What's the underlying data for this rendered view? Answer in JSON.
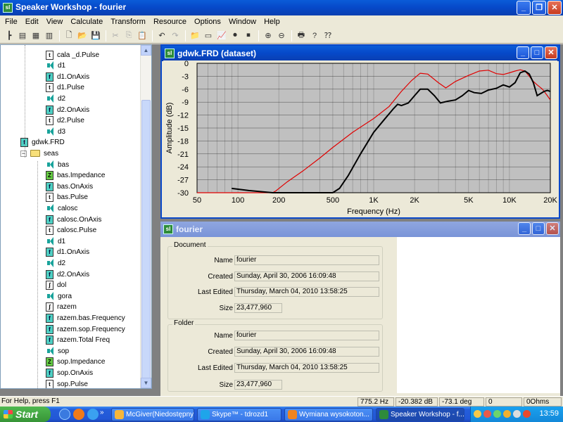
{
  "app": {
    "title": "Speaker Workshop - fourier",
    "icon_label": "sl"
  },
  "menu": [
    "File",
    "Edit",
    "View",
    "Calculate",
    "Transform",
    "Resource",
    "Options",
    "Window",
    "Help"
  ],
  "tree": {
    "items": [
      {
        "label": "cala _d.Pulse",
        "icon": "t",
        "indent": 2
      },
      {
        "label": "d1",
        "icon": "spk",
        "indent": 2
      },
      {
        "label": "d1.OnAxis",
        "icon": "f",
        "indent": 2
      },
      {
        "label": "d1.Pulse",
        "icon": "t",
        "indent": 2
      },
      {
        "label": "d2",
        "icon": "spk",
        "indent": 2
      },
      {
        "label": "d2.OnAxis",
        "icon": "f",
        "indent": 2
      },
      {
        "label": "d2.Pulse",
        "icon": "t",
        "indent": 2
      },
      {
        "label": "d3",
        "icon": "spk",
        "indent": 2
      },
      {
        "label": "gdwk.FRD",
        "icon": "f",
        "indent": 1
      },
      {
        "label": "seas",
        "icon": "folder",
        "indent": 1
      },
      {
        "label": "bas",
        "icon": "spk",
        "indent": 2
      },
      {
        "label": "bas.Impedance",
        "icon": "z",
        "indent": 2
      },
      {
        "label": "bas.OnAxis",
        "icon": "f",
        "indent": 2
      },
      {
        "label": "bas.Pulse",
        "icon": "t",
        "indent": 2
      },
      {
        "label": "calosc",
        "icon": "spk",
        "indent": 2
      },
      {
        "label": "calosc.OnAxis",
        "icon": "f",
        "indent": 2
      },
      {
        "label": "calosc.Pulse",
        "icon": "t",
        "indent": 2
      },
      {
        "label": "d1",
        "icon": "spk",
        "indent": 2
      },
      {
        "label": "d1.OnAxis",
        "icon": "f",
        "indent": 2
      },
      {
        "label": "d2",
        "icon": "spk",
        "indent": 2
      },
      {
        "label": "d2.OnAxis",
        "icon": "f",
        "indent": 2
      },
      {
        "label": "dol",
        "icon": "g",
        "indent": 2
      },
      {
        "label": "gora",
        "icon": "spk",
        "indent": 2
      },
      {
        "label": "razem",
        "icon": "g",
        "indent": 2
      },
      {
        "label": "razem.bas.Frequency",
        "icon": "f",
        "indent": 2
      },
      {
        "label": "razem.sop.Frequency",
        "icon": "f",
        "indent": 2
      },
      {
        "label": "razem.Total Freq",
        "icon": "f",
        "indent": 2
      },
      {
        "label": "sop",
        "icon": "spk",
        "indent": 2
      },
      {
        "label": "sop.Impedance",
        "icon": "z",
        "indent": 2
      },
      {
        "label": "sop.OnAxis",
        "icon": "f",
        "indent": 2
      },
      {
        "label": "sop.Pulse",
        "icon": "t",
        "indent": 2
      }
    ]
  },
  "chart_window": {
    "title": "gdwk.FRD (dataset)"
  },
  "chart_data": {
    "type": "line",
    "xscale": "log",
    "xlabel": "Frequency (Hz)",
    "ylabel": "Amplitude (dB)",
    "xlim": [
      50,
      20000
    ],
    "ylim": [
      -30,
      0
    ],
    "x_ticks": [
      50,
      100,
      200,
      500,
      1000,
      2000,
      5000,
      10000,
      20000
    ],
    "x_tick_labels": [
      "50",
      "100",
      "200",
      "500",
      "1K",
      "2K",
      "5K",
      "10K",
      "20K"
    ],
    "y_ticks": [
      0,
      -3,
      -6,
      -9,
      -12,
      -15,
      -18,
      -21,
      -24,
      -27,
      -30
    ],
    "y_tick_labels": [
      "0",
      "-3",
      "-6",
      "-9",
      "-12",
      "-15",
      "-18",
      "-21",
      "-24",
      "-27",
      "-30"
    ],
    "grid": true,
    "background": "#c0c0c0",
    "series": [
      {
        "color": "#e00000",
        "points": [
          [
            50,
            -30
          ],
          [
            100,
            -30
          ],
          [
            180,
            -30
          ],
          [
            190,
            -29.6
          ],
          [
            230,
            -27.5
          ],
          [
            300,
            -25
          ],
          [
            400,
            -22
          ],
          [
            500,
            -19.5
          ],
          [
            700,
            -16
          ],
          [
            1000,
            -12.8
          ],
          [
            1300,
            -10
          ],
          [
            1600,
            -6.5
          ],
          [
            1900,
            -4
          ],
          [
            2200,
            -2.3
          ],
          [
            2500,
            -2.5
          ],
          [
            3000,
            -4.5
          ],
          [
            3400,
            -5.7
          ],
          [
            4000,
            -4.2
          ],
          [
            5000,
            -2.8
          ],
          [
            6000,
            -1.8
          ],
          [
            7000,
            -1.6
          ],
          [
            8000,
            -2.4
          ],
          [
            9000,
            -2.6
          ],
          [
            10000,
            -2.2
          ],
          [
            11000,
            -1.8
          ],
          [
            12000,
            -1.5
          ],
          [
            13000,
            -1.8
          ],
          [
            14000,
            -3
          ],
          [
            15000,
            -4.2
          ],
          [
            16000,
            -5
          ],
          [
            17500,
            -6
          ],
          [
            19000,
            -7.5
          ],
          [
            20000,
            -8.5
          ]
        ]
      },
      {
        "color": "#000000",
        "points": [
          [
            90,
            -29
          ],
          [
            120,
            -29.5
          ],
          [
            180,
            -30
          ],
          [
            300,
            -30
          ],
          [
            500,
            -30
          ],
          [
            560,
            -29
          ],
          [
            650,
            -26
          ],
          [
            800,
            -21
          ],
          [
            1000,
            -16
          ],
          [
            1200,
            -13
          ],
          [
            1400,
            -10.5
          ],
          [
            1500,
            -9.5
          ],
          [
            1600,
            -9.8
          ],
          [
            1800,
            -9.2
          ],
          [
            2000,
            -7.5
          ],
          [
            2200,
            -6
          ],
          [
            2500,
            -6
          ],
          [
            2800,
            -7.5
          ],
          [
            3100,
            -9.2
          ],
          [
            3500,
            -8.8
          ],
          [
            4000,
            -8.5
          ],
          [
            4500,
            -7.5
          ],
          [
            5000,
            -6.3
          ],
          [
            5500,
            -6.8
          ],
          [
            6200,
            -7
          ],
          [
            7000,
            -6.2
          ],
          [
            8000,
            -5.8
          ],
          [
            9000,
            -5
          ],
          [
            10000,
            -5.5
          ],
          [
            11000,
            -4.5
          ],
          [
            12000,
            -2.2
          ],
          [
            13000,
            -1.8
          ],
          [
            14000,
            -2.5
          ],
          [
            15000,
            -4.5
          ],
          [
            16000,
            -7.5
          ],
          [
            17000,
            -7
          ],
          [
            18000,
            -6.5
          ],
          [
            19000,
            -6.3
          ],
          [
            20000,
            -6.5
          ]
        ]
      }
    ]
  },
  "info_window": {
    "title": "fourier",
    "document": {
      "legend": "Document",
      "name_label": "Name",
      "name": "fourier",
      "created_label": "Created",
      "created": "Sunday, April 30, 2006 16:09:48",
      "edited_label": "Last Edited",
      "edited": "Thursday, March 04, 2010 13:58:25",
      "size_label": "Size",
      "size": "23,477,960"
    },
    "folder": {
      "legend": "Folder",
      "name_label": "Name",
      "name": "fourier",
      "created_label": "Created",
      "created": "Sunday, April 30, 2006 16:09:48",
      "edited_label": "Last Edited",
      "edited": "Thursday, March 04, 2010 13:58:25",
      "size_label": "Size",
      "size": "23,477,960"
    }
  },
  "status": {
    "message": "For Help, press F1",
    "freq": "775.2 Hz",
    "db": "-20.382 dB",
    "deg": "-73.1 deg",
    "count": "0",
    "ohms": "0Ohms"
  },
  "taskbar": {
    "start": "Start",
    "tasks": [
      {
        "label": "McGiver(Niedostępny...",
        "color": "#f6b63a"
      },
      {
        "label": "Skype™ - tdrozd1",
        "color": "#1ea5ea"
      },
      {
        "label": "Wymiana wysokoton...",
        "color": "#f0841e"
      },
      {
        "label": "Speaker Workshop - f...",
        "color": "#2e8b3a"
      }
    ],
    "clock": "13:59"
  }
}
